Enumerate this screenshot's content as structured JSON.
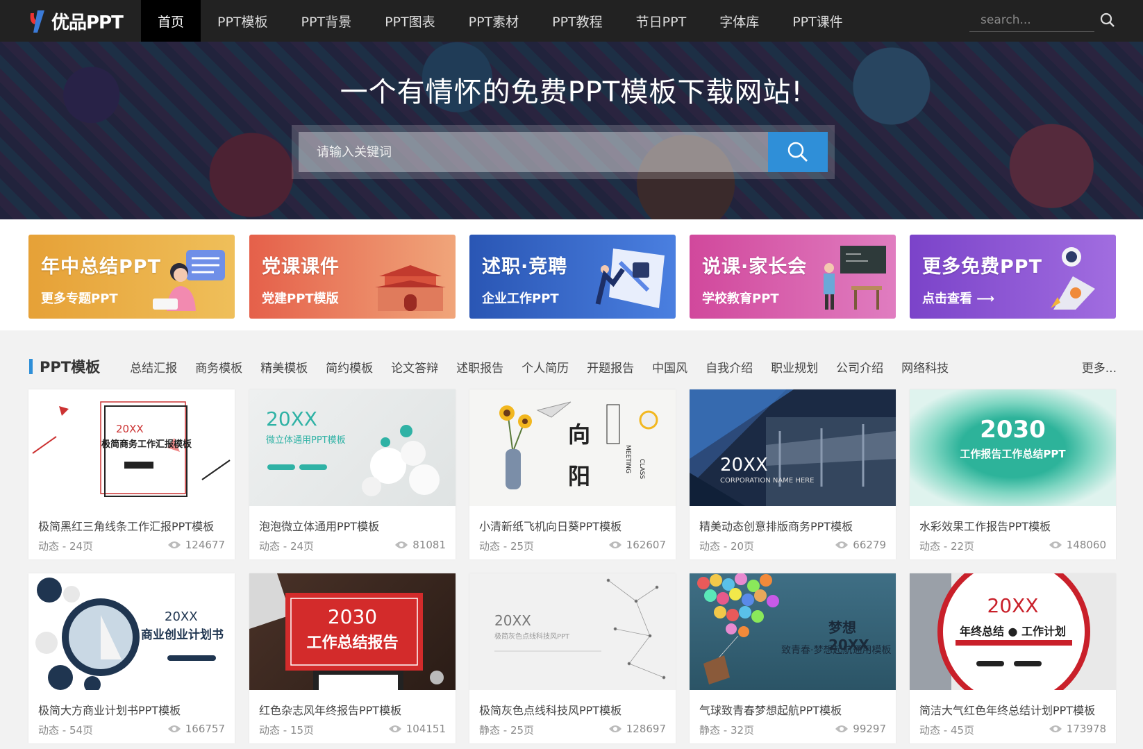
{
  "nav": {
    "logo_text": "优品PPT",
    "items": [
      "首页",
      "PPT模板",
      "PPT背景",
      "PPT图表",
      "PPT素材",
      "PPT教程",
      "节日PPT",
      "字体库",
      "PPT课件"
    ],
    "search_placeholder": "search..."
  },
  "hero": {
    "title": "一个有情怀的免费PPT模板下载网站!",
    "search_placeholder": "请输入关键词"
  },
  "banners": [
    {
      "title": "年中总结PPT",
      "subtitle": "更多专题PPT",
      "color": "#e8a53a"
    },
    {
      "title": "党课课件",
      "subtitle": "党建PPT模版",
      "color": "#e2674f"
    },
    {
      "title": "述职·竞聘",
      "subtitle": "企业工作PPT",
      "color": "#2d59b8"
    },
    {
      "title": "说课·家长会",
      "subtitle": "学校教育PPT",
      "color": "#d558a6"
    },
    {
      "title": "更多免费PPT",
      "subtitle": "点击查看 ⟶",
      "color": "#8a4ed0"
    }
  ],
  "section": {
    "title": "PPT模板",
    "tags": [
      "总结汇报",
      "商务模板",
      "精美模板",
      "简约模板",
      "论文答辩",
      "述职报告",
      "个人简历",
      "开题报告",
      "中国风",
      "自我介绍",
      "职业规划",
      "公司介绍",
      "网络科技"
    ],
    "more": "更多..."
  },
  "cards": [
    {
      "title": "极简黑红三角线条工作汇报PPT模板",
      "meta": "动态 - 24页",
      "views": "124677",
      "thumb_line1": "20XX",
      "thumb_line2": "极简商务工作汇报模板"
    },
    {
      "title": "泡泡微立体通用PPT模板",
      "meta": "动态 - 24页",
      "views": "81081",
      "thumb_line1": "20XX",
      "thumb_line2": "微立体通用PPT模板"
    },
    {
      "title": "小清新纸飞机向日葵PPT模板",
      "meta": "动态 - 25页",
      "views": "162607",
      "thumb_line1": "向",
      "thumb_line2": "阳"
    },
    {
      "title": "精美动态创意排版商务PPT模板",
      "meta": "动态 - 20页",
      "views": "66279",
      "thumb_line1": "20XX",
      "thumb_line2": "CORPORATION NAME HERE"
    },
    {
      "title": "水彩效果工作报告PPT模板",
      "meta": "动态 - 22页",
      "views": "148060",
      "thumb_line1": "2030",
      "thumb_line2": "工作报告工作总结PPT"
    },
    {
      "title": "极简大方商业计划书PPT模板",
      "meta": "动态 - 54页",
      "views": "166757",
      "thumb_line1": "20XX",
      "thumb_line2": "商业创业计划书"
    },
    {
      "title": "红色杂志风年终报告PPT模板",
      "meta": "动态 - 15页",
      "views": "104151",
      "thumb_line1": "2030",
      "thumb_line2": "工作总结报告"
    },
    {
      "title": "极简灰色点线科技风PPT模板",
      "meta": "静态 - 25页",
      "views": "128697",
      "thumb_line1": "20XX",
      "thumb_line2": "极简灰色点线科技风PPT"
    },
    {
      "title": "气球致青春梦想起航PPT模板",
      "meta": "静态 - 32页",
      "views": "99297",
      "thumb_line1": "梦想 20XX",
      "thumb_line2": "致青春·梦想起航通用模板"
    },
    {
      "title": "简洁大气红色年终总结计划PPT模板",
      "meta": "动态 - 45页",
      "views": "173978",
      "thumb_line1": "20XX",
      "thumb_line2": "年终总结 ● 工作计划"
    }
  ],
  "colors": {
    "accent": "#2f8fd8",
    "nav_bg": "#222222"
  }
}
